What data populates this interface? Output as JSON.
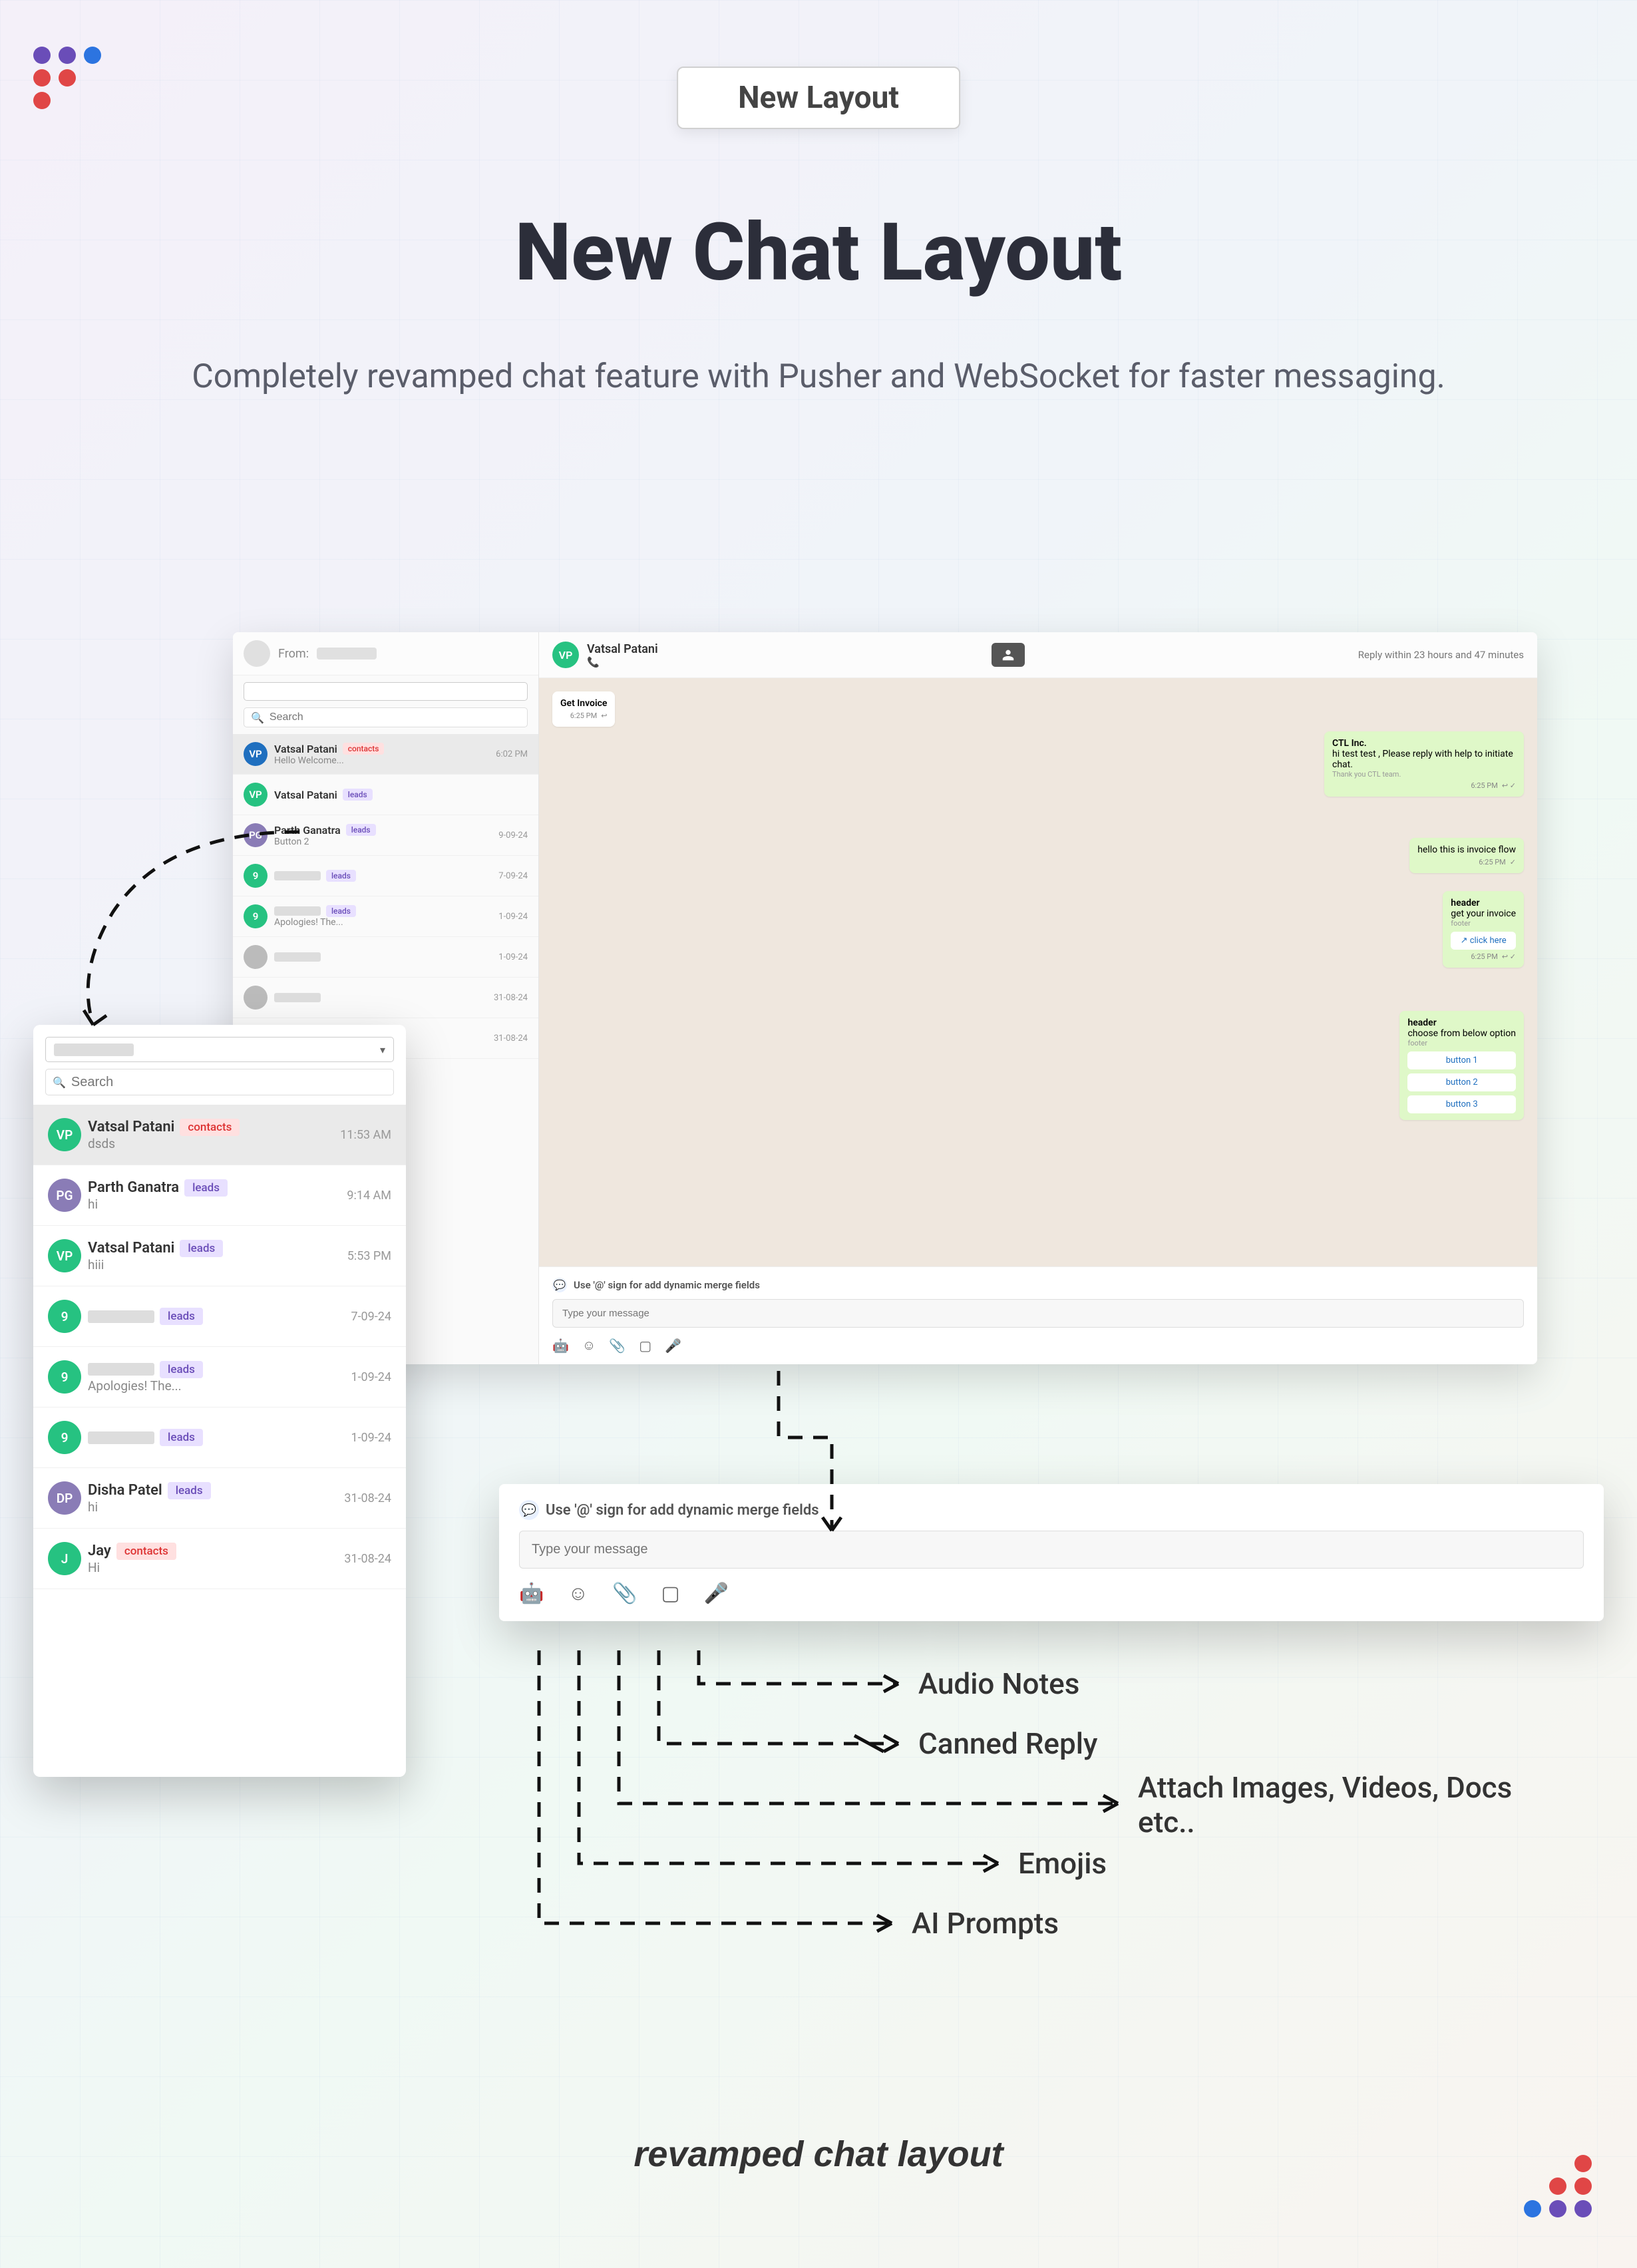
{
  "badge": "New Layout",
  "hero_title": "New Chat Layout",
  "hero_sub": "Completely revamped chat feature with Pusher and WebSocket for faster messaging.",
  "from_label": "From:",
  "search_placeholder": "Search",
  "contacts_main": [
    {
      "initials": "VP",
      "name": "Vatsal Patani",
      "tag": "contacts",
      "sub": "Hello Welcome...",
      "time": "6:02 PM",
      "av": "av-blue",
      "active": true
    },
    {
      "initials": "VP",
      "name": "Vatsal Patani",
      "tag": "leads",
      "sub": "",
      "time": "",
      "av": "av-green"
    },
    {
      "initials": "PG",
      "name": "Parth Ganatra",
      "tag": "leads",
      "sub": "Button 2",
      "time": "9-09-24",
      "av": "av-purple"
    },
    {
      "initials": "9",
      "name": "",
      "tag": "leads",
      "sub": "",
      "time": "7-09-24",
      "av": "av-green"
    },
    {
      "initials": "9",
      "name": "",
      "tag": "leads",
      "sub": "Apologies! The...",
      "time": "1-09-24",
      "av": "av-green"
    },
    {
      "initials": "",
      "name": "",
      "tag": "",
      "sub": "",
      "time": "1-09-24",
      "av": ""
    },
    {
      "initials": "",
      "name": "",
      "tag": "",
      "sub": "",
      "time": "31-08-24",
      "av": ""
    },
    {
      "initials": "",
      "name": "",
      "tag": "",
      "sub": "",
      "time": "31-08-24",
      "av": ""
    }
  ],
  "contacts_overlay": [
    {
      "initials": "VP",
      "name": "Vatsal Patani",
      "tag": "contacts",
      "sub": "dsds",
      "time": "11:53 AM",
      "av": "av-green",
      "active": true
    },
    {
      "initials": "PG",
      "name": "Parth Ganatra",
      "tag": "leads",
      "sub": "hi",
      "time": "9:14 AM",
      "av": "av-purple"
    },
    {
      "initials": "VP",
      "name": "Vatsal Patani",
      "tag": "leads",
      "sub": "hiii",
      "time": "5:53 PM",
      "av": "av-green"
    },
    {
      "initials": "9",
      "name": "",
      "tag": "leads",
      "sub": "",
      "time": "7-09-24",
      "av": "av-green"
    },
    {
      "initials": "9",
      "name": "",
      "tag": "leads",
      "sub": "Apologies! The...",
      "time": "1-09-24",
      "av": "av-green"
    },
    {
      "initials": "9",
      "name": "",
      "tag": "leads",
      "sub": "",
      "time": "1-09-24",
      "av": "av-green"
    },
    {
      "initials": "DP",
      "name": "Disha Patel",
      "tag": "leads",
      "sub": "hi",
      "time": "31-08-24",
      "av": "av-purple"
    },
    {
      "initials": "J",
      "name": "Jay",
      "tag": "contacts",
      "sub": "Hi",
      "time": "31-08-24",
      "av": "av-green"
    }
  ],
  "chat_header": {
    "initials": "VP",
    "name": "Vatsal Patani",
    "phone": "📞",
    "reply_notice": "Reply within 23 hours and 47 minutes"
  },
  "messages": {
    "get_invoice": {
      "label": "Get Invoice",
      "time": "6:25 PM"
    },
    "ctl": {
      "title": "CTL Inc.",
      "body": "hi test test , Please reply with help to initiate chat.",
      "thanks": "Thank you CTL team.",
      "time": "6:25 PM"
    },
    "flow": {
      "body": "hello this is invoice flow",
      "time": "6:25 PM"
    },
    "header1": {
      "head": "header",
      "body": "get your invoice",
      "footer": "footer",
      "btn": "↗ click here",
      "time": "6:25 PM"
    },
    "header2": {
      "head": "header",
      "body": "choose from below option",
      "footer": "footer",
      "btn1": "button 1",
      "btn2": "button 2",
      "btn3": "button 3"
    }
  },
  "compose_hint": "Use '@' sign for add dynamic merge fields",
  "compose_placeholder": "Type your message",
  "features": {
    "audio": "Audio Notes",
    "canned": "Canned Reply",
    "attach": "Attach Images, Videos, Docs etc..",
    "emojis": "Emojis",
    "ai": "AI Prompts"
  },
  "footer_caption": "revamped chat layout",
  "logo_colors": {
    "purple": "#6a4db8",
    "blue": "#2c74e0",
    "red": "#e04646"
  }
}
